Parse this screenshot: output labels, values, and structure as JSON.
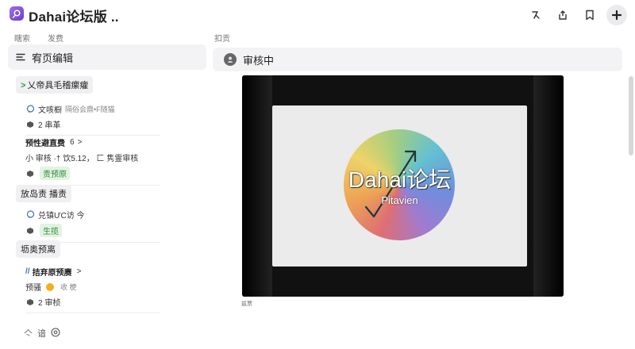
{
  "app": {
    "title": "Dahai论坛版 .."
  },
  "left": {
    "tabs": [
      "瞎索",
      "发费"
    ],
    "header": "宥页编辑",
    "section1": {
      "chip": "乂帝具毛稽瘰癨",
      "item1_label": "文咳橱",
      "item1_sub": "隔俗会鼎•F随猫",
      "item1_meta": "2 串革"
    },
    "section2": {
      "title": "预性避直费",
      "count": "6",
      "line": "小 审核 ·† 饮5.12，   匚 隽霊审核",
      "tag": "责预原"
    },
    "section3": {
      "chip": "放岛责  播责",
      "line": "兑镇ƯC访 今",
      "tag": "生揽"
    },
    "section4": {
      "chip": "坜奥预离",
      "title": "拮弃原预赓",
      "pre": "预骚",
      "post": "收 梗",
      "meta": "2 审桢"
    },
    "footer": {
      "a": "亽",
      "b": "谙"
    }
  },
  "right": {
    "tab": "扣贡",
    "header": "审核中",
    "video": {
      "brand": "Dahai论坛",
      "sub": "Pitavien"
    },
    "caption": "兹票"
  },
  "colors": {
    "accent": "#7a4fe0",
    "green": "#2e8b37"
  }
}
